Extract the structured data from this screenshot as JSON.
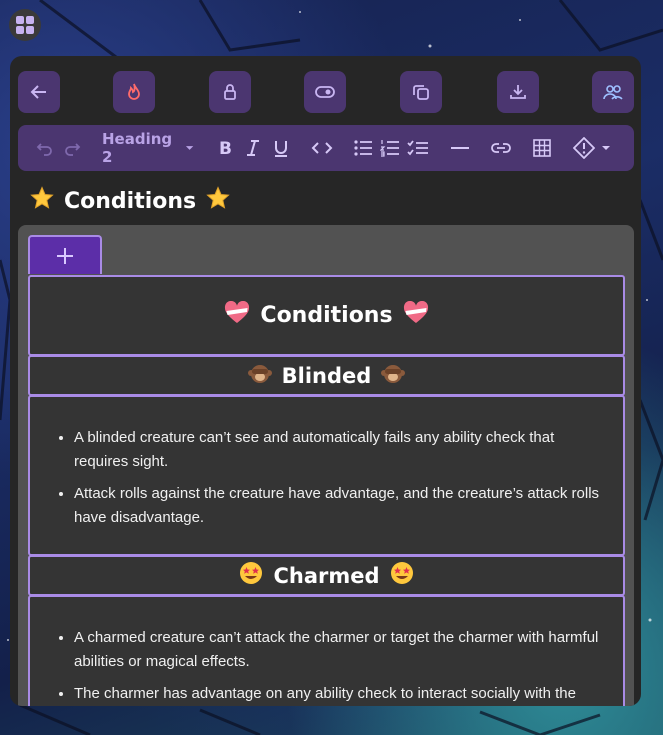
{
  "toolbar": {
    "buttons": [
      "back-arrow-icon",
      "fire-icon",
      "lock-icon",
      "toggle-icon",
      "copy-icon",
      "download-icon",
      "users-icon"
    ]
  },
  "editor": {
    "heading_select": "Heading 2"
  },
  "page": {
    "title": "Conditions"
  },
  "sections": {
    "main_title": "Conditions",
    "blinded": {
      "heading": "Blinded",
      "bullets": [
        "A blinded creature can’t see and automatically fails any ability check that requires sight.",
        "Attack rolls against the creature have advantage, and the creature’s attack rolls have disadvantage."
      ]
    },
    "charmed": {
      "heading": "Charmed",
      "bullets": [
        "A charmed creature can’t attack the charmer or target the charmer with harmful abilities or magical effects.",
        "The charmer has advantage on any ability check to interact socially with the"
      ]
    }
  },
  "colors": {
    "accent": "#a98be6",
    "toolbar_bg": "#4b3670",
    "panel_bg": "#262626"
  }
}
